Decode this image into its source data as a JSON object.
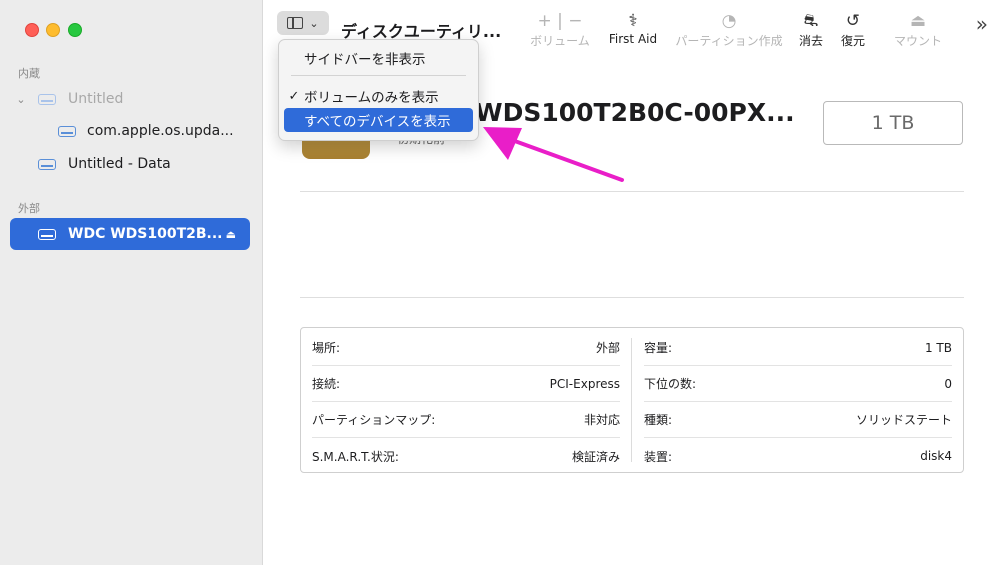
{
  "sidebar": {
    "section_internal": "内蔵",
    "section_external": "外部",
    "items": [
      {
        "label": "Untitled"
      },
      {
        "label": "com.apple.os.upda..."
      },
      {
        "label": "Untitled - Data"
      },
      {
        "label": "WDC WDS100T2B..."
      }
    ]
  },
  "toolbar": {
    "title": "ディスクユーティリ...",
    "volume_label": "ボリューム",
    "firstaid_label": "First Aid",
    "partition_label": "パーティション作成",
    "erase_label": "消去",
    "restore_label": "復元",
    "mount_label": "マウント"
  },
  "menu": {
    "item1": "サイドバーを非表示",
    "item2": "ボリュームのみを表示",
    "item3": "すべてのデバイスを表示"
  },
  "device": {
    "name": "WDS100T2B0C-00PX...",
    "subtitle": "初期化前",
    "capacity": "1 TB"
  },
  "info": {
    "left": [
      {
        "label": "場所:",
        "value": "外部"
      },
      {
        "label": "接続:",
        "value": "PCI-Express"
      },
      {
        "label": "パーティションマップ:",
        "value": "非対応"
      },
      {
        "label": "S.M.A.R.T.状況:",
        "value": "検証済み"
      }
    ],
    "right": [
      {
        "label": "容量:",
        "value": "1 TB"
      },
      {
        "label": "下位の数:",
        "value": "0"
      },
      {
        "label": "種類:",
        "value": "ソリッドステート"
      },
      {
        "label": "装置:",
        "value": "disk4"
      }
    ]
  },
  "colors": {
    "accent": "#2f6bd9",
    "annotation_arrow": "#e91ec8"
  }
}
